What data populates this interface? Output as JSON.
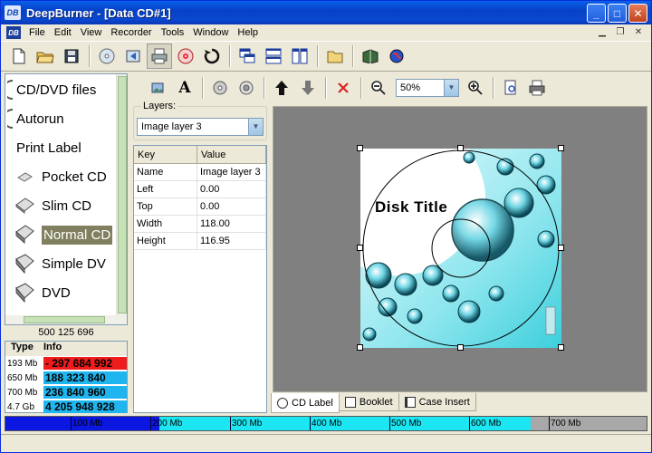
{
  "window": {
    "title": "DeepBurner - [Data CD#1]",
    "app_badge": "DB"
  },
  "menu": [
    "File",
    "Edit",
    "View",
    "Recorder",
    "Tools",
    "Window",
    "Help"
  ],
  "nav": {
    "items": [
      {
        "label": "CD/DVD files",
        "indent": 0
      },
      {
        "label": "Autorun",
        "indent": 0
      },
      {
        "label": "Print Label",
        "indent": 0
      },
      {
        "label": "Pocket CD",
        "indent": 1
      },
      {
        "label": "Slim CD",
        "indent": 1
      },
      {
        "label": "Normal CD",
        "indent": 1,
        "selected": true
      },
      {
        "label": "Simple DV",
        "indent": 1
      },
      {
        "label": "DVD",
        "indent": 1
      }
    ]
  },
  "free_space": "500 125 696",
  "capacity": {
    "head_type": "Type",
    "head_info": "Info",
    "rows": [
      {
        "type": "193 Mb",
        "value": "- 297 684 992",
        "color": "#ee1c1c"
      },
      {
        "type": "650 Mb",
        "value": "188 323 840",
        "color": "#1fb6f0"
      },
      {
        "type": "700 Mb",
        "value": "236 840 960",
        "color": "#1fb6f0"
      },
      {
        "type": "4.7 Gb",
        "value": "4 205 948 928",
        "color": "#1fb6f0"
      }
    ]
  },
  "layers": {
    "legend": "Layers:",
    "selected": "Image layer 3"
  },
  "props": {
    "head_key": "Key",
    "head_value": "Value",
    "rows": [
      {
        "key": "Name",
        "value": "Image layer 3"
      },
      {
        "key": "Left",
        "value": "0.00"
      },
      {
        "key": "Top",
        "value": "0.00"
      },
      {
        "key": "Width",
        "value": "118.00"
      },
      {
        "key": "Height",
        "value": "116.95"
      }
    ]
  },
  "zoom": "50%",
  "label": {
    "disk_title": "Disk Title"
  },
  "tabs": [
    {
      "label": "CD Label",
      "active": true
    },
    {
      "label": "Booklet"
    },
    {
      "label": "Case Insert"
    }
  ],
  "capbar_ticks": [
    "100 Mb",
    "200 Mb",
    "300 Mb",
    "400 Mb",
    "500 Mb",
    "600 Mb",
    "700 Mb"
  ]
}
